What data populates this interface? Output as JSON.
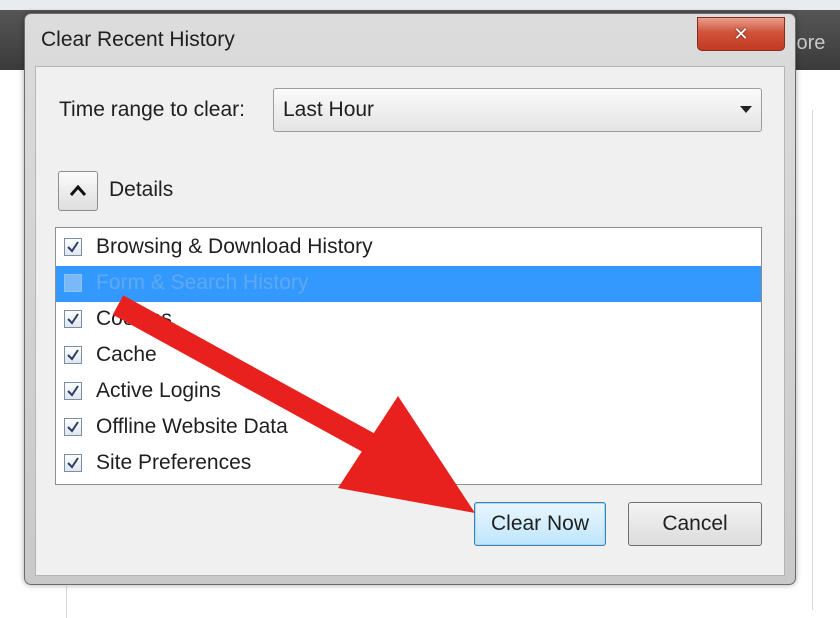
{
  "background": {
    "more_text": "lore"
  },
  "dialog": {
    "title": "Clear Recent History",
    "close_glyph": "✕",
    "time_range_label": "Time range to clear:",
    "time_range_value": "Last Hour",
    "details_label": "Details",
    "items": [
      {
        "label": "Browsing & Download History",
        "checked": true,
        "selected": false
      },
      {
        "label": "Form & Search History",
        "checked": false,
        "selected": true
      },
      {
        "label": "Cookies",
        "checked": true,
        "selected": false
      },
      {
        "label": "Cache",
        "checked": true,
        "selected": false
      },
      {
        "label": "Active Logins",
        "checked": true,
        "selected": false
      },
      {
        "label": "Offline Website Data",
        "checked": true,
        "selected": false
      },
      {
        "label": "Site Preferences",
        "checked": true,
        "selected": false
      }
    ],
    "clear_now_label": "Clear Now",
    "cancel_label": "Cancel"
  },
  "colors": {
    "selection": "#3399ff",
    "annotation_arrow": "#e8201e",
    "close_button": "#c8452d"
  }
}
